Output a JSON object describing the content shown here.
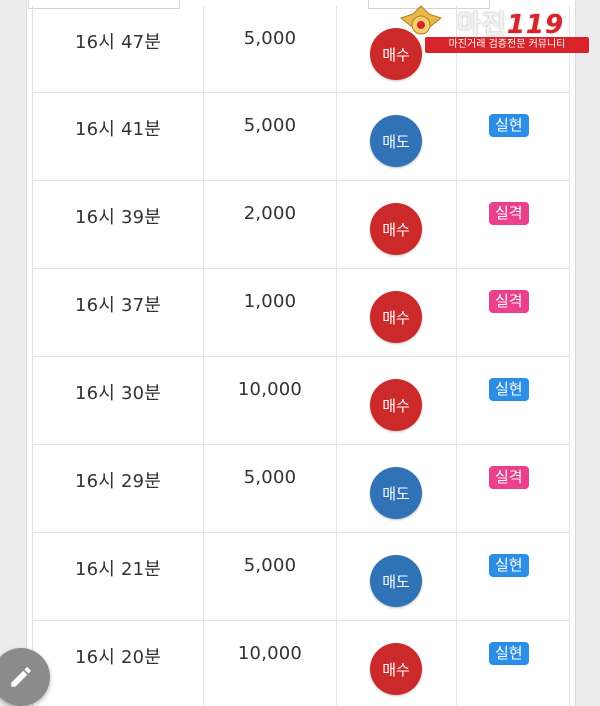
{
  "watermark": {
    "brand": "마진",
    "number": "119",
    "tagline": "마진거래 검증전문 커뮤니티"
  },
  "labels": {
    "buy": "매수",
    "sell": "매도",
    "hit": "실현",
    "miss": "실격"
  },
  "rows": [
    {
      "time": "16시 47분",
      "amount": "5,000",
      "side": "매수",
      "status": ""
    },
    {
      "time": "16시 41분",
      "amount": "5,000",
      "side": "매도",
      "status": "실현"
    },
    {
      "time": "16시 39분",
      "amount": "2,000",
      "side": "매수",
      "status": "실격"
    },
    {
      "time": "16시 37분",
      "amount": "1,000",
      "side": "매수",
      "status": "실격"
    },
    {
      "time": "16시 30분",
      "amount": "10,000",
      "side": "매수",
      "status": "실현"
    },
    {
      "time": "16시 29분",
      "amount": "5,000",
      "side": "매도",
      "status": "실격"
    },
    {
      "time": "16시 21분",
      "amount": "5,000",
      "side": "매도",
      "status": "실현"
    },
    {
      "time": "16시 20분",
      "amount": "10,000",
      "side": "매수",
      "status": "실현"
    }
  ],
  "colors": {
    "buy": "#cc2a2a",
    "sell": "#2f72b5",
    "hit": "#2b8ee6",
    "miss": "#ec3f8e"
  },
  "icons": {
    "fab": "pencil-icon",
    "logo": "emblem-icon"
  }
}
